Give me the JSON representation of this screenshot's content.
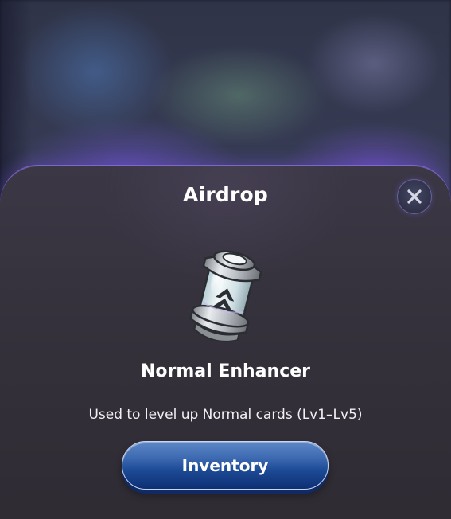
{
  "dialog": {
    "title": "Airdrop",
    "close_icon": "close-icon"
  },
  "item": {
    "icon": "normal-enhancer-icon",
    "name": "Normal Enhancer",
    "description": "Used to level up Normal cards (Lv1–Lv5)"
  },
  "actions": {
    "inventory_label": "Inventory"
  },
  "colors": {
    "sheet_background": "#36323d",
    "button_primary": "#1d4b96",
    "sheet_glow": "#8c6ee0"
  }
}
